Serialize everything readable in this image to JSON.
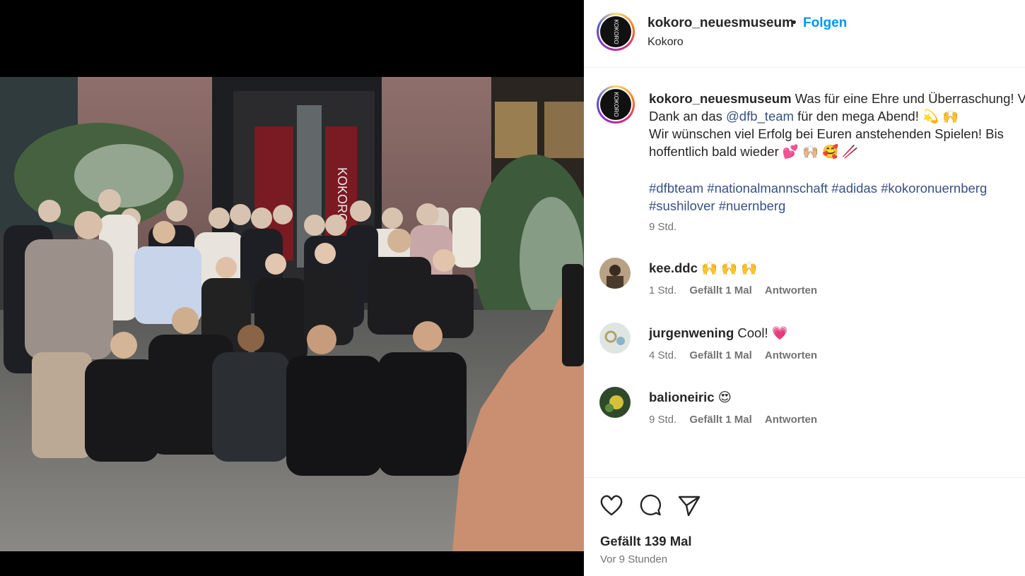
{
  "post": {
    "account": {
      "username": "kokoro_neuesmuseum",
      "separator": "•",
      "follow_label": "Folgen",
      "location": "Kokoro",
      "avatar_text": "KOKORO"
    },
    "photo": {
      "sign_text": "KOKORO"
    },
    "caption": {
      "username": "kokoro_neuesmuseum",
      "line1": "Was für eine Ehre und Überraschung! V",
      "line2_a": "Dank an das ",
      "mention": "@dfb_team",
      "line2_b": " für den mega Abend! 💫 🙌",
      "line3": "Wir wünschen viel Erfolg bei Euren anstehenden Spielen! Bis",
      "line4": "hoffentlich bald wieder 💕 🙌🏼 🥰 🥢",
      "tags_line1": "#dfbteam #nationalmannschaft #adidas #kokoronuernberg",
      "tags_line2": "#sushilover #nuernberg",
      "time": "9 Std."
    },
    "comments": [
      {
        "user": "kee.ddc",
        "text": "🙌 🙌 🙌",
        "time": "1 Std.",
        "likes": "Gefällt 1 Mal",
        "reply": "Antworten"
      },
      {
        "user": "jurgenwening",
        "text": "Cool! 💗",
        "time": "4 Std.",
        "likes": "Gefällt 1 Mal",
        "reply": "Antworten"
      },
      {
        "user": "balioneiric",
        "text": "😍",
        "time": "9 Std.",
        "likes": "Gefällt 1 Mal",
        "reply": "Antworten"
      }
    ],
    "footer": {
      "likes": "Gefällt 139 Mal",
      "ago": "Vor 9 Stunden"
    },
    "icons": [
      "heart-icon",
      "comment-icon",
      "share-icon"
    ],
    "colors": {
      "follow": "#0095f6",
      "link": "#385185",
      "muted": "#737373"
    }
  }
}
